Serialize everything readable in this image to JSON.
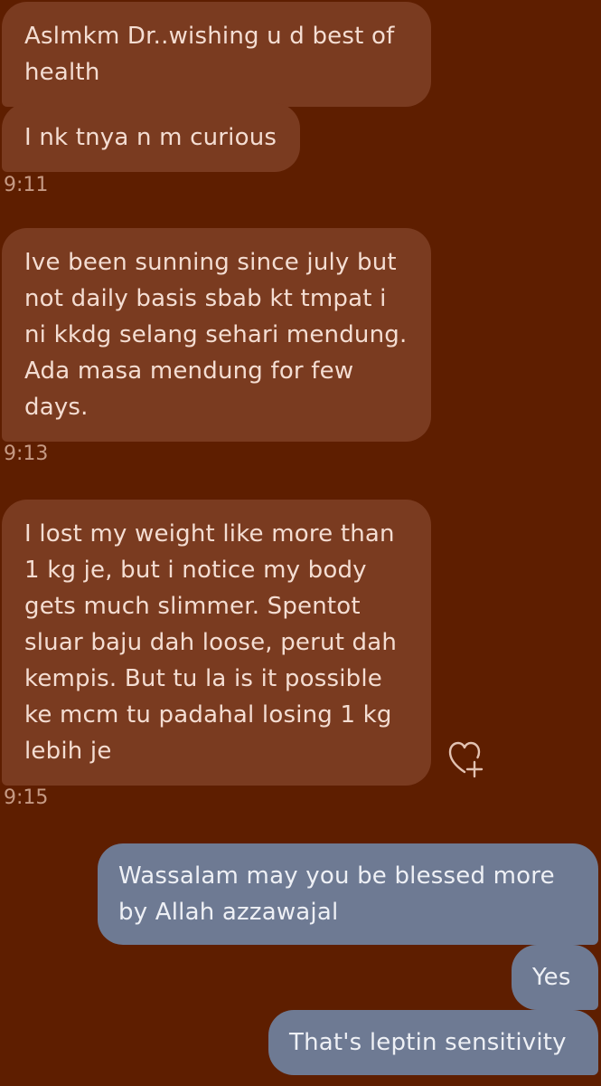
{
  "messages": [
    {
      "text": "Aslmkm Dr..wishing u d best of health"
    },
    {
      "text": "I nk tnya n m curious"
    },
    {
      "text": "Ive been sunning since july but not daily basis sbab kt tmpat i ni kkdg selang sehari mendung. Ada masa mendung for few days."
    },
    {
      "text": "I lost my weight like more than 1 kg je, but i notice my body gets much slimmer. Spentot sluar baju dah loose, perut dah kempis. But tu la is it possible ke mcm tu padahal losing 1 kg lebih je"
    },
    {
      "text": "Wassalam may you be blessed more by Allah azzawajal"
    },
    {
      "text": "Yes"
    },
    {
      "text": "That's leptin sensitivity"
    }
  ],
  "timestamps": [
    "9:11",
    "9:13",
    "9:15"
  ],
  "icons": {
    "react": "heart-plus-icon"
  },
  "colors": {
    "background": "#5e1e00",
    "incoming_bubble": "#7a3b20",
    "outgoing_bubble": "#6e7a93",
    "timestamp": "#c69a84"
  }
}
